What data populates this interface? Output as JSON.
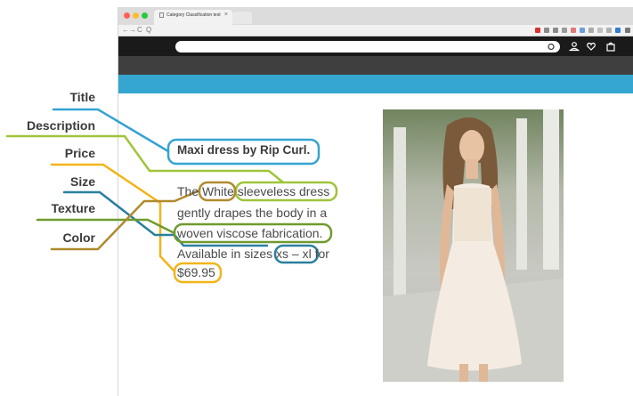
{
  "browser": {
    "tab_title": "Category Classification test",
    "tab_close": "×",
    "address": "Q",
    "nav_back": "←",
    "nav_forward": "→",
    "nav_reload": "C"
  },
  "labels": {
    "title": "Title",
    "description": "Description",
    "price": "Price",
    "size": "Size",
    "texture": "Texture",
    "color": "Color"
  },
  "product": {
    "title": "Maxi dress by Rip Curl.",
    "line1_pre": "The ",
    "color_word": "White",
    "line1_post": " sleeveless dress",
    "line2": "gently drapes the body in a",
    "line3": "woven viscose fabrication.",
    "line4_pre": "Available in sizes ",
    "sizes": "xs – xl",
    "line4_post": " for",
    "price": "$69.95"
  },
  "colors": {
    "title": "#36a3d1",
    "description": "#9fc43a",
    "price": "#f2b418",
    "size": "#2a7f9e",
    "texture": "#6f9a2e",
    "color": "#b08a2e"
  }
}
